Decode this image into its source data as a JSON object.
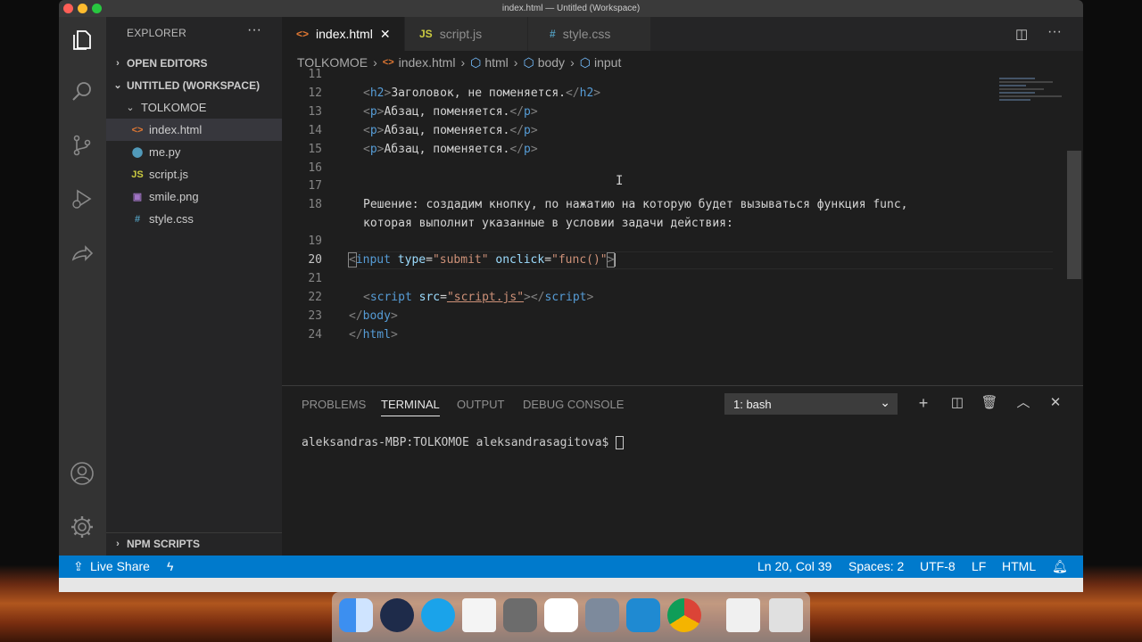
{
  "window": {
    "title": "index.html — Untitled (Workspace)"
  },
  "sidebar": {
    "header": "EXPLORER",
    "more": "···",
    "sections": [
      {
        "label": "OPEN EDITORS"
      },
      {
        "label": "UNTITLED (WORKSPACE)"
      },
      {
        "label": "TOLKOMOE"
      }
    ],
    "files": [
      {
        "name": "index.html",
        "icon": "html-file-icon",
        "glyph": "<>",
        "color": "#e37933"
      },
      {
        "name": "me.py",
        "icon": "python-file-icon",
        "glyph": "⬤",
        "color": "#519aba"
      },
      {
        "name": "script.js",
        "icon": "js-file-icon",
        "glyph": "JS",
        "color": "#cbcb41"
      },
      {
        "name": "smile.png",
        "icon": "image-file-icon",
        "glyph": "▣",
        "color": "#a074c4"
      },
      {
        "name": "style.css",
        "icon": "css-file-icon",
        "glyph": "#",
        "color": "#519aba"
      }
    ],
    "npm": "NPM SCRIPTS"
  },
  "tabs": [
    {
      "label": "index.html",
      "glyph": "<>",
      "close": "✕"
    },
    {
      "label": "script.js",
      "glyph": "JS"
    },
    {
      "label": "style.css",
      "glyph": "#"
    }
  ],
  "breadcrumb": {
    "folder": "TOLKOMOE",
    "file": "index.html",
    "html": "html",
    "body": "body",
    "input": "input",
    "sep": "›"
  },
  "code": {
    "line_numbers": [
      "11",
      "12",
      "13",
      "14",
      "15",
      "16",
      "17",
      "18",
      "",
      "19",
      "20",
      "21",
      "22",
      "23",
      "24"
    ],
    "h2_text": "Заголовок, не поменяется.",
    "p_text": "Абзац, поменяется.",
    "comment_1": "Решение: создадим кнопку, по нажатию на которую будет вызываться функция func,",
    "comment_2": "которая выполнит указанные в условии задачи действия:",
    "input_type_value": "\"submit\"",
    "input_onclick_value": "\"func()\"",
    "script_src_value": "\"script.js\""
  },
  "panel": {
    "tabs": [
      "PROBLEMS",
      "TERMINAL",
      "OUTPUT",
      "DEBUG CONSOLE"
    ],
    "active_tab": "TERMINAL",
    "shell": "1: bash",
    "prompt": "aleksandras-MBP:TOLKOMOE aleksandrasagitova$ "
  },
  "status": {
    "live_share": "Live Share",
    "position": "Ln 20, Col 39",
    "spaces": "Spaces: 2",
    "encoding": "UTF-8",
    "eol": "LF",
    "language": "HTML"
  },
  "colors": {
    "accent": "#007acc",
    "tag": "#569cd6",
    "attribute": "#9cdcfe",
    "string": "#ce9178"
  }
}
